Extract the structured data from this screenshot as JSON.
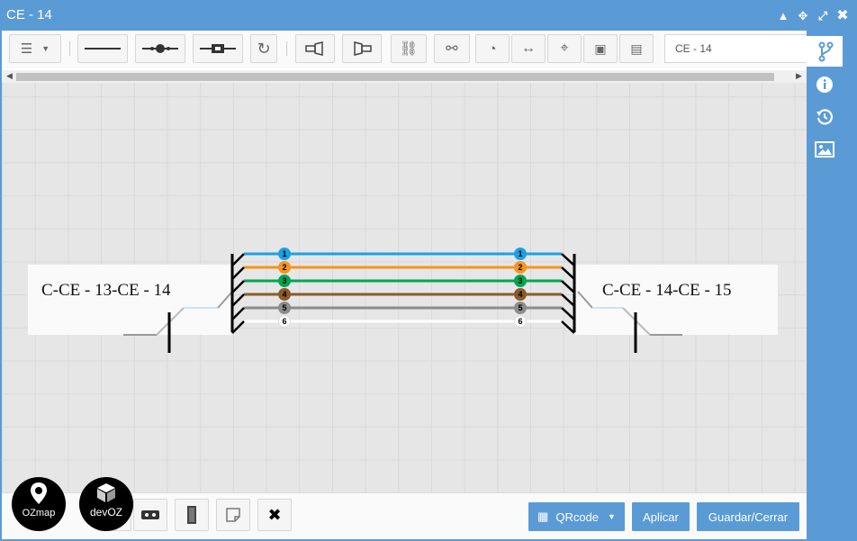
{
  "window": {
    "title": "CE - 14"
  },
  "toolbar": {
    "name_value": "CE - 14"
  },
  "cables": {
    "left_label": "C-CE - 13-CE - 14",
    "right_label": "C-CE - 14-CE - 15"
  },
  "fibers": [
    {
      "number": "1",
      "color": "#1ba1e2"
    },
    {
      "number": "2",
      "color": "#f7941d"
    },
    {
      "number": "3",
      "color": "#00a651"
    },
    {
      "number": "4",
      "color": "#8b5a2b"
    },
    {
      "number": "5",
      "color": "#8c8c8c"
    },
    {
      "number": "6",
      "color": "#ffffff"
    }
  ],
  "bottom": {
    "qrcode_label": "QRcode",
    "apply_label": "Aplicar",
    "save_close_label": "Guardar/Cerrar"
  },
  "logos": {
    "ozmap_text": "OZmap",
    "devoz_text": "devOZ"
  },
  "colors": {
    "accent": "#5b9bd5",
    "grid_bg": "#e6e6e6"
  }
}
